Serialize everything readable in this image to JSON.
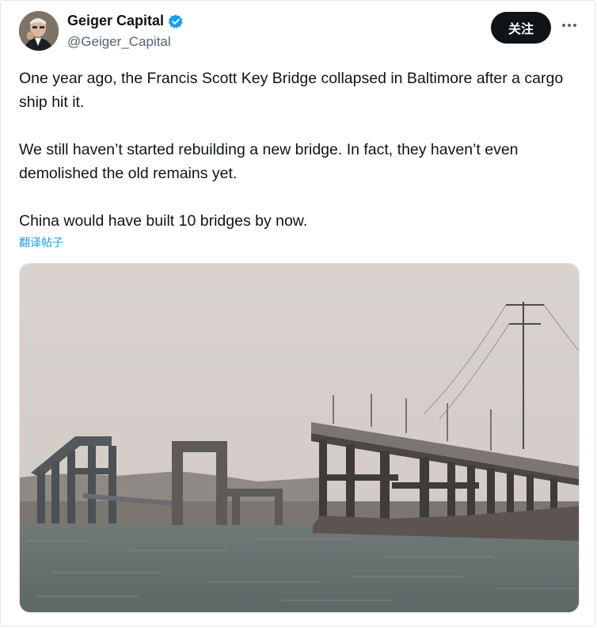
{
  "author": {
    "display_name": "Geiger Capital",
    "handle": "@Geiger_Capital",
    "verified": true,
    "verified_color": "#1d9bf0"
  },
  "actions": {
    "follow_label": "关注",
    "more_icon": "more-horizontal-icon"
  },
  "tweet": {
    "paragraphs": [
      "One year ago, the Francis Scott Key Bridge collapsed in Baltimore after a cargo ship hit it.",
      "We still haven’t started rebuilding a new bridge. In fact, they haven’t even demolished the old remains yet.",
      "China would have built 10 bridges by now."
    ],
    "translate_label": "翻译帖子"
  },
  "media": {
    "icon": "photo-bridge-remains"
  },
  "colors": {
    "text": "#0f1419",
    "secondary": "#536471",
    "link": "#1d9bf0",
    "button": "#0f1419"
  }
}
